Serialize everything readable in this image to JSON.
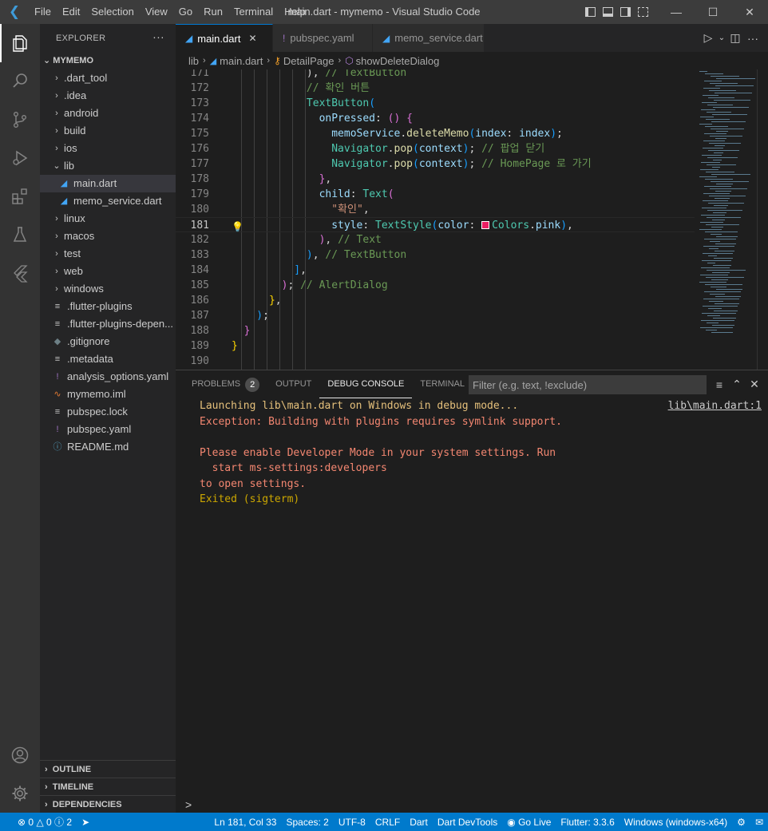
{
  "titlebar": {
    "menu": [
      "File",
      "Edit",
      "Selection",
      "View",
      "Go",
      "Run",
      "Terminal",
      "Help"
    ],
    "title": "main.dart - mymemo - Visual Studio Code",
    "logo": "vscode-logo-icon"
  },
  "sidebar": {
    "header": "EXPLORER",
    "root": "MYMEMO",
    "items": [
      {
        "label": ".dart_tool",
        "type": "folder",
        "depth": 0
      },
      {
        "label": ".idea",
        "type": "folder",
        "depth": 0
      },
      {
        "label": "android",
        "type": "folder",
        "depth": 0
      },
      {
        "label": "build",
        "type": "folder",
        "depth": 0
      },
      {
        "label": "ios",
        "type": "folder",
        "depth": 0
      },
      {
        "label": "lib",
        "type": "folder-open",
        "depth": 0
      },
      {
        "label": "main.dart",
        "type": "dart",
        "depth": 1
      },
      {
        "label": "memo_service.dart",
        "type": "dart",
        "depth": 1
      },
      {
        "label": "linux",
        "type": "folder",
        "depth": 0
      },
      {
        "label": "macos",
        "type": "folder",
        "depth": 0
      },
      {
        "label": "test",
        "type": "folder",
        "depth": 0
      },
      {
        "label": "web",
        "type": "folder",
        "depth": 0
      },
      {
        "label": "windows",
        "type": "folder",
        "depth": 0
      },
      {
        "label": ".flutter-plugins",
        "type": "lines",
        "depth": 0
      },
      {
        "label": ".flutter-plugins-depen...",
        "type": "lines",
        "depth": 0
      },
      {
        "label": ".gitignore",
        "type": "git",
        "depth": 0
      },
      {
        "label": ".metadata",
        "type": "lines",
        "depth": 0
      },
      {
        "label": "analysis_options.yaml",
        "type": "yaml",
        "depth": 0
      },
      {
        "label": "mymemo.iml",
        "type": "rss",
        "depth": 0
      },
      {
        "label": "pubspec.lock",
        "type": "lines",
        "depth": 0
      },
      {
        "label": "pubspec.yaml",
        "type": "yaml",
        "depth": 0
      },
      {
        "label": "README.md",
        "type": "info",
        "depth": 0
      }
    ],
    "selected_index": 6,
    "sections": [
      "OUTLINE",
      "TIMELINE",
      "DEPENDENCIES"
    ]
  },
  "tabs": [
    {
      "label": "main.dart",
      "icon": "dart-icon",
      "active": true
    },
    {
      "label": "pubspec.yaml",
      "icon": "yaml-icon",
      "active": false
    },
    {
      "label": "memo_service.dart",
      "icon": "dart-icon",
      "active": false
    }
  ],
  "breadcrumb": [
    "lib",
    "main.dart",
    "DetailPage",
    "showDeleteDialog"
  ],
  "editor": {
    "current_line": 181,
    "lines": [
      {
        "n": "171",
        "tokens": [
          [
            "p",
            "            ), "
          ],
          [
            "c",
            "// TextButton"
          ]
        ]
      },
      {
        "n": "172",
        "tokens": [
          [
            "c",
            "            // 확인 버튼"
          ]
        ]
      },
      {
        "n": "173",
        "tokens": [
          [
            "t",
            "            TextButton"
          ],
          [
            "b3",
            "("
          ]
        ]
      },
      {
        "n": "174",
        "tokens": [
          [
            "k",
            "              onPressed"
          ],
          [
            "p",
            ": "
          ],
          [
            "b2",
            "() {"
          ]
        ]
      },
      {
        "n": "175",
        "tokens": [
          [
            "k",
            "                memoService"
          ],
          [
            "p",
            "."
          ],
          [
            "f",
            "deleteMemo"
          ],
          [
            "b3",
            "("
          ],
          [
            "k",
            "index"
          ],
          [
            "p",
            ": "
          ],
          [
            "k",
            "index"
          ],
          [
            "b3",
            ")"
          ],
          [
            "p",
            ";"
          ]
        ]
      },
      {
        "n": "176",
        "tokens": [
          [
            "t",
            "                Navigator"
          ],
          [
            "p",
            "."
          ],
          [
            "f",
            "pop"
          ],
          [
            "b3",
            "("
          ],
          [
            "k",
            "context"
          ],
          [
            "b3",
            ")"
          ],
          [
            "p",
            "; "
          ],
          [
            "c",
            "// 팝업 닫기"
          ]
        ]
      },
      {
        "n": "177",
        "tokens": [
          [
            "t",
            "                Navigator"
          ],
          [
            "p",
            "."
          ],
          [
            "f",
            "pop"
          ],
          [
            "b3",
            "("
          ],
          [
            "k",
            "context"
          ],
          [
            "b3",
            ")"
          ],
          [
            "p",
            "; "
          ],
          [
            "c",
            "// HomePage 로 가기"
          ]
        ]
      },
      {
        "n": "178",
        "tokens": [
          [
            "b2",
            "              }"
          ],
          [
            "p",
            ","
          ]
        ]
      },
      {
        "n": "179",
        "tokens": [
          [
            "k",
            "              child"
          ],
          [
            "p",
            ": "
          ],
          [
            "t",
            "Text"
          ],
          [
            "b2",
            "("
          ]
        ]
      },
      {
        "n": "180",
        "tokens": [
          [
            "s",
            "                \"확인\""
          ],
          [
            "p",
            ","
          ]
        ]
      },
      {
        "n": "181",
        "tokens": [
          [
            "k",
            "                style"
          ],
          [
            "p",
            ": "
          ],
          [
            "t",
            "TextStyle"
          ],
          [
            "b3",
            "("
          ],
          [
            "k",
            "color"
          ],
          [
            "p",
            ": "
          ],
          [
            "swatch",
            ""
          ],
          [
            "t",
            "Colors"
          ],
          [
            "p",
            "."
          ],
          [
            "k",
            "pink"
          ],
          [
            "b3",
            ")"
          ],
          [
            "p",
            ","
          ]
        ]
      },
      {
        "n": "182",
        "tokens": [
          [
            "b2",
            "              )"
          ],
          [
            "p",
            ", "
          ],
          [
            "c",
            "// Text"
          ]
        ]
      },
      {
        "n": "183",
        "tokens": [
          [
            "b3",
            "            )"
          ],
          [
            "p",
            ", "
          ],
          [
            "c",
            "// TextButton"
          ]
        ]
      },
      {
        "n": "184",
        "tokens": [
          [
            "b3",
            "          ]"
          ],
          [
            "p",
            ","
          ]
        ]
      },
      {
        "n": "185",
        "tokens": [
          [
            "b2",
            "        )"
          ],
          [
            "p",
            "; "
          ],
          [
            "c",
            "// AlertDialog"
          ]
        ]
      },
      {
        "n": "186",
        "tokens": [
          [
            "b1",
            "      }"
          ],
          [
            "p",
            ","
          ]
        ]
      },
      {
        "n": "187",
        "tokens": [
          [
            "b3",
            "    )"
          ],
          [
            "p",
            ";"
          ]
        ]
      },
      {
        "n": "188",
        "tokens": [
          [
            "b2",
            "  }"
          ]
        ]
      },
      {
        "n": "189",
        "tokens": [
          [
            "b1",
            "}"
          ]
        ]
      },
      {
        "n": "190",
        "tokens": []
      }
    ]
  },
  "panel": {
    "tabs": [
      {
        "label": "PROBLEMS",
        "badge": "2",
        "active": false
      },
      {
        "label": "OUTPUT",
        "badge": null,
        "active": false
      },
      {
        "label": "DEBUG CONSOLE",
        "badge": null,
        "active": true
      },
      {
        "label": "TERMINAL",
        "badge": null,
        "active": false
      }
    ],
    "filter_placeholder": "Filter (e.g. text, !exclude)",
    "source_link": "lib\\main.dart:1",
    "console": [
      {
        "text": "Launching lib\\main.dart on Windows in debug mode...",
        "color": "orange"
      },
      {
        "text": "Exception: Building with plugins requires symlink support.",
        "color": "red"
      },
      {
        "text": "",
        "color": "red"
      },
      {
        "text": "Please enable Developer Mode in your system settings. Run",
        "color": "red"
      },
      {
        "text": "  start ms-settings:developers",
        "color": "red"
      },
      {
        "text": "to open settings.",
        "color": "red"
      },
      {
        "text": "Exited (sigterm)",
        "color": "yellow"
      }
    ],
    "prompt": ">"
  },
  "statusbar": {
    "errors": "0",
    "warnings": "0",
    "info": "2",
    "position": "Ln 181, Col 33",
    "spaces": "Spaces: 2",
    "encoding": "UTF-8",
    "eol": "CRLF",
    "language": "Dart",
    "devtools": "Dart DevTools",
    "golive": "Go Live",
    "flutter": "Flutter: 3.3.6",
    "device": "Windows (windows-x64)"
  }
}
